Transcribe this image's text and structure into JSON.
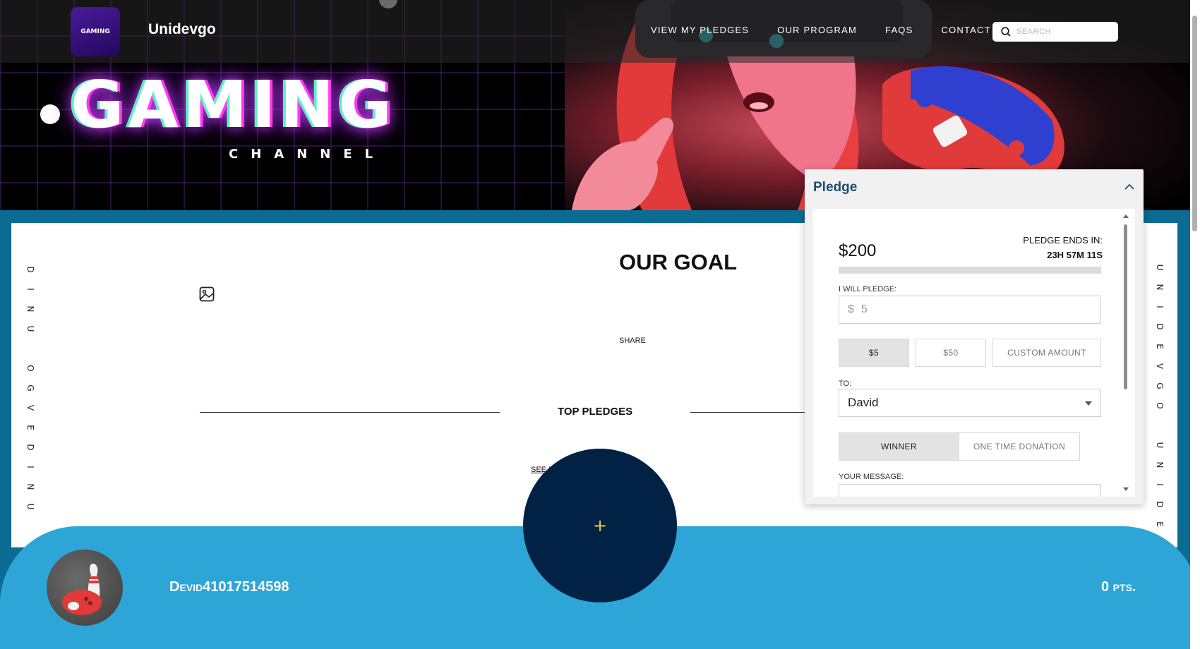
{
  "header": {
    "brand": "Unidevgo",
    "logo_text": "GAMING",
    "nav": [
      "VIEW MY PLEDGES",
      "OUR PROGRAM",
      "FAQS",
      "CONTACT"
    ],
    "search_placeholder": "SEARCH"
  },
  "hero": {
    "title": "GAMING",
    "subtitle": "CHANNEL"
  },
  "side_text": {
    "left": [
      "D",
      "I",
      "N",
      "U",
      "",
      "O",
      "G",
      "V",
      "E",
      "D",
      "I",
      "N",
      "U"
    ],
    "right": [
      "U",
      "N",
      "I",
      "D",
      "E",
      "V",
      "G",
      "O",
      "",
      "U",
      "N",
      "I",
      "D",
      "E"
    ]
  },
  "main": {
    "goal_title": "OUR GOAL",
    "share": "SHARE",
    "top_pledges": "TOP PLEDGES",
    "see_link": "SEE I                          D"
  },
  "pledge_panel": {
    "title": "Pledge",
    "amount": "$200",
    "ends_label": "PLEDGE ENDS IN:",
    "ends_time": "23H 57M 11S",
    "progress": 0,
    "will_pledge_label": "I WILL PLEDGE:",
    "currency": "$",
    "input_value": "5",
    "amount_options": [
      "$5",
      "$50",
      "CUSTOM AMOUNT"
    ],
    "to_label": "TO:",
    "to_value": "David",
    "type_options": [
      "WINNER",
      "ONE TIME DONATION"
    ],
    "message_label": "YOUR MESSAGE:"
  },
  "footer": {
    "username": "Devid41017514598",
    "points": "0 pts.",
    "fab_label": "+"
  },
  "colors": {
    "accent_navy": "#1d4f6f",
    "bar_blue": "#2da5d6",
    "fab_navy": "#022245",
    "fab_plus": "#f0c830"
  }
}
